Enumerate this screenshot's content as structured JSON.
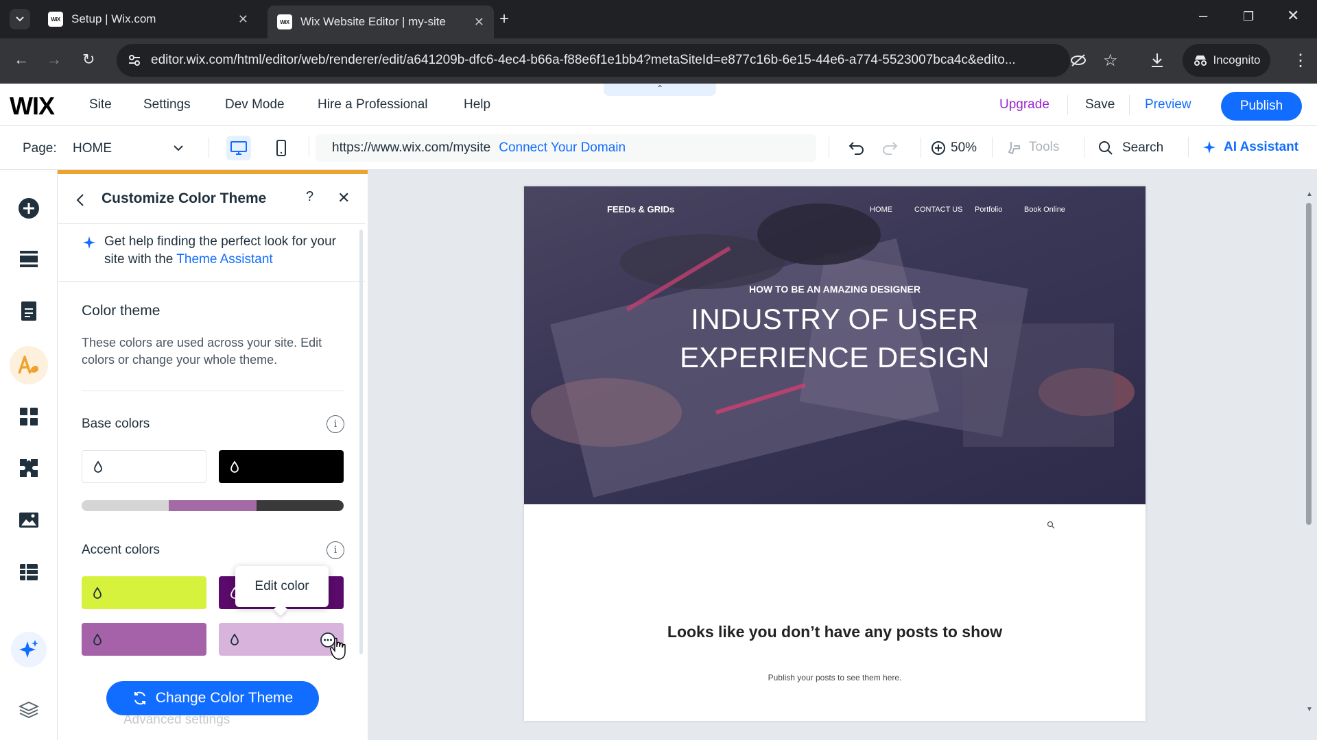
{
  "browser": {
    "tabs": [
      {
        "title": "Setup | Wix.com",
        "favicon": "WiX"
      },
      {
        "title": "Wix Website Editor | my-site",
        "favicon": "WiX"
      }
    ],
    "url": "editor.wix.com/html/editor/web/renderer/edit/a641209b-dfc6-4ec4-b66a-f88e6f1e1bb4?metaSiteId=e877c16b-6e15-44e6-a774-5523007bca4c&edito...",
    "incognito_label": "Incognito"
  },
  "wix_bar": {
    "logo": "WIX",
    "menu": [
      "Site",
      "Settings",
      "Dev Mode",
      "Hire a Professional",
      "Help"
    ],
    "collapse": "⌃",
    "upgrade": "Upgrade",
    "save": "Save",
    "preview": "Preview",
    "publish": "Publish"
  },
  "page_bar": {
    "page_label": "Page:",
    "page_value": "HOME",
    "site_url": "https://www.wix.com/mysite",
    "connect_domain": "Connect Your Domain",
    "zoom": "50%",
    "tools": "Tools",
    "search": "Search",
    "ai_assistant": "AI Assistant"
  },
  "panel": {
    "title": "Customize Color Theme",
    "help": "?",
    "close": "✕",
    "tip_prefix": "Get help finding the perfect look for your site with the ",
    "tip_link": "Theme Assistant",
    "section_title": "Color theme",
    "section_desc": "These colors are used across your site. Edit colors or change your whole theme.",
    "base_colors_label": "Base colors",
    "base_colors": [
      "#ffffff",
      "#000000"
    ],
    "base_gradient": [
      "#d5d5d5",
      "#a46aa5",
      "#3a3a3a"
    ],
    "accent_colors_label": "Accent colors",
    "accent_colors": [
      "#d7f23c",
      "#5a0a6a",
      "#a562a8",
      "#d8b4dc"
    ],
    "tooltip": "Edit color",
    "change_button": "Change Color Theme",
    "advanced": "Advanced settings"
  },
  "site": {
    "logo": "FEEDs & GRIDs",
    "nav": [
      "HOME",
      "CONTACT US",
      "Portfolio",
      "Book Online"
    ],
    "hero_kicker": "HOW TO BE AN AMAZING DESIGNER",
    "hero_title_1": "INDUSTRY OF USER",
    "hero_title_2": "EXPERIENCE DESIGN",
    "no_posts_title": "Looks like you don’t have any posts to show",
    "no_posts_sub": "Publish your posts to see them here."
  },
  "colors": {
    "accent_blue": "#116dff",
    "upgrade_purple": "#9a27d5",
    "panel_highlight": "#f0a22e"
  }
}
